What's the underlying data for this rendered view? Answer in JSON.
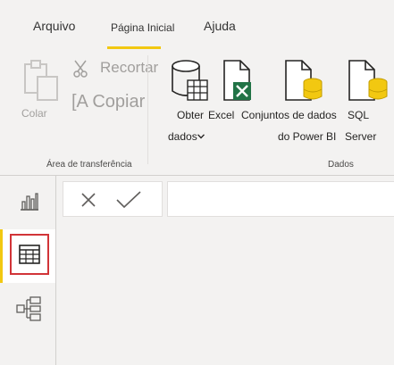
{
  "tabs": {
    "file": "Arquivo",
    "home": "Página Inicial",
    "help": "Ajuda",
    "accent_color": "#f2c811"
  },
  "clipboard": {
    "paste_label": "Colar",
    "cut_label": "Recortar",
    "copy_label": "[A Copiar",
    "group_label": "Área de transferência"
  },
  "data_group": {
    "get_data_label_line1": "Obter",
    "get_data_label_line2": "dados",
    "excel_label": "Excel",
    "datasets_label": "Conjuntos de dados",
    "datasets_label_line2": "do Power BI",
    "sql_label_line1": "SQL",
    "sql_label_line2": "Server",
    "group_label": "Dados"
  },
  "rail": {
    "items": [
      "report-view",
      "data-view",
      "model-view"
    ],
    "selected": "data-view",
    "focus_color": "#d13438"
  },
  "formula_bar": {
    "cancel_icon": "close-icon",
    "commit_icon": "check-icon",
    "value": ""
  }
}
